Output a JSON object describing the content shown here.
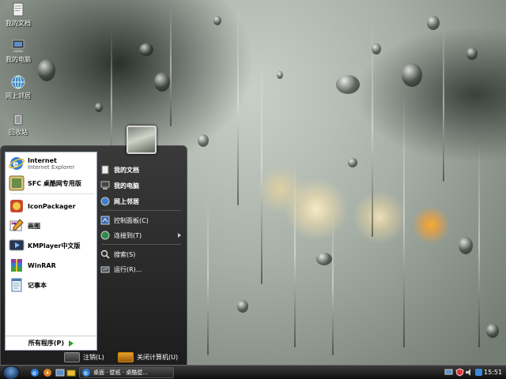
{
  "desktop": {
    "icons": [
      {
        "label": "我的文档",
        "icon": "my-documents-icon"
      },
      {
        "label": "我的电脑",
        "icon": "my-computer-icon"
      },
      {
        "label": "网上邻居",
        "icon": "network-places-icon"
      },
      {
        "label": "回收站",
        "icon": "recycle-bin-icon"
      }
    ]
  },
  "start_menu": {
    "pinned": [
      {
        "label": "Internet",
        "sublabel": "Internet Explorer",
        "icon": "internet-explorer-icon"
      },
      {
        "label": "SFC 桌酷网专用版",
        "icon": "sfc-icon"
      }
    ],
    "recent": [
      {
        "label": "IconPackager",
        "icon": "iconpackager-icon"
      },
      {
        "label": "画图",
        "icon": "paint-icon"
      },
      {
        "label": "KMPlayer中文版",
        "icon": "kmplayer-icon"
      },
      {
        "label": "WinRAR",
        "icon": "winrar-icon"
      },
      {
        "label": "记事本",
        "icon": "notepad-icon"
      }
    ],
    "all_programs": "所有程序(P)",
    "places": [
      {
        "label": "我的文档"
      },
      {
        "label": "我的电脑"
      },
      {
        "label": "网上邻居"
      }
    ],
    "system": [
      {
        "label": "控制面板(C)"
      },
      {
        "label": "连接到(T)"
      }
    ],
    "tools": [
      {
        "label": "搜索(S)"
      },
      {
        "label": "运行(R)..."
      }
    ],
    "logoff": "注销(L)",
    "shutdown": "关闭计算机(U)"
  },
  "taskbar": {
    "task_button": "桌面 · 壁纸 · 桌酷壁...",
    "clock": "15:51"
  },
  "colors": {
    "menu_bg": "#2b2b2b",
    "left_pane": "#ffffff",
    "all_programs_arrow": "#2a9a2a",
    "taskbar": "#1a1a1a"
  }
}
